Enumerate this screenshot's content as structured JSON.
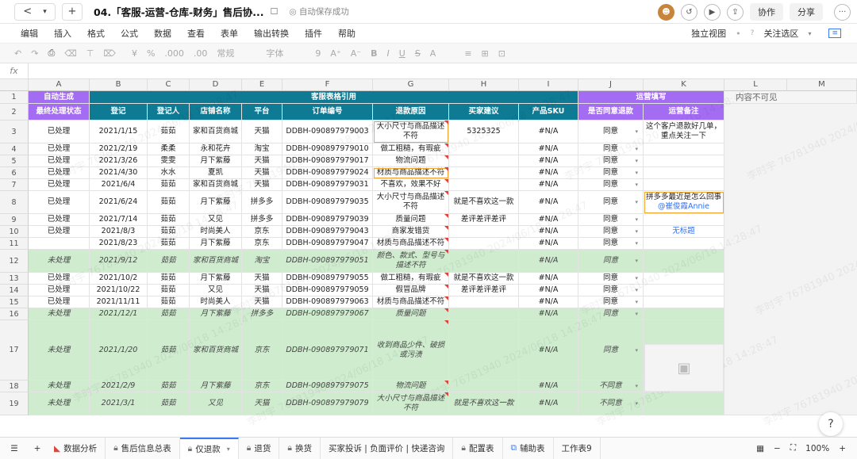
{
  "titlebar": {
    "back": "<",
    "chev": "▾",
    "add": "+",
    "title": "04.「客服-运营-仓库-财务」售后协...",
    "bookmark": "☐",
    "saved": "自动保存成功",
    "collab": "协作",
    "share": "分享",
    "more": "···"
  },
  "menus": [
    "编辑",
    "插入",
    "格式",
    "公式",
    "数据",
    "查看",
    "表单",
    "输出转换",
    "插件",
    "帮助"
  ],
  "menu_right": {
    "view": "独立视图",
    "dot": "•",
    "chev": "?",
    "focus": "关注选区",
    "chev2": "▾"
  },
  "toolbar": [
    "↶",
    "↷",
    "⎙",
    "⌫",
    "⊤",
    "⌦",
    "¥",
    "%",
    ".000",
    ".00",
    "常规",
    "字体",
    "9",
    "A⁺",
    "A⁻",
    "B",
    "I",
    "U",
    "S",
    "A",
    "≡",
    "⊞",
    "⊡"
  ],
  "fx": "fx",
  "columns": [
    "A",
    "B",
    "C",
    "D",
    "E",
    "F",
    "G",
    "H",
    "I",
    "J",
    "K",
    "L",
    "M"
  ],
  "header1": {
    "a": "自动生成",
    "bi": "客服表格引用",
    "jk": "运营填写",
    "l": "内容不可见"
  },
  "header2": [
    "最终处理状态",
    "登记",
    "登记人",
    "店铺名称",
    "平台",
    "订单编号",
    "退款原因",
    "买家建议",
    "产品SKU",
    "是否同意退款",
    "运营备注"
  ],
  "rows": [
    {
      "n": "3",
      "a": "已处理",
      "b": "2021/1/15",
      "c": "茹茹",
      "d": "家和百货商城",
      "e": "天猫",
      "f": "DDBH-090897979003",
      "g": "大小尺寸与商品描述不符",
      "h": "5325325",
      "i": "#N/A",
      "j": "同意",
      "k": "这个客户退款好几单，重点关注一下"
    },
    {
      "n": "4",
      "a": "已处理",
      "b": "2021/2/19",
      "c": "柔柔",
      "d": "永和花卉",
      "e": "淘宝",
      "f": "DDBH-090897979010",
      "g": "做工粗糙，有瑕疵",
      "h": "",
      "i": "#N/A",
      "j": "同意",
      "k": ""
    },
    {
      "n": "5",
      "a": "已处理",
      "b": "2021/3/26",
      "c": "雯雯",
      "d": "月下紫藤",
      "e": "天猫",
      "f": "DDBH-090897979017",
      "g": "物流问题",
      "h": "",
      "i": "#N/A",
      "j": "同意",
      "k": ""
    },
    {
      "n": "6",
      "a": "已处理",
      "b": "2021/4/30",
      "c": "水水",
      "d": "夏凯",
      "e": "天猫",
      "f": "DDBH-090897979024",
      "g": "材质与商品描述不符",
      "h": "",
      "i": "#N/A",
      "j": "同意",
      "k": ""
    },
    {
      "n": "7",
      "a": "已处理",
      "b": "2021/6/4",
      "c": "茹茹",
      "d": "家和百货商城",
      "e": "天猫",
      "f": "DDBH-090897979031",
      "g": "不喜欢，效果不好",
      "h": "",
      "i": "#N/A",
      "j": "同意",
      "k": ""
    },
    {
      "n": "8",
      "a": "已处理",
      "b": "2021/6/24",
      "c": "茹茹",
      "d": "月下紫藤",
      "e": "拼多多",
      "f": "DDBH-090897979035",
      "g": "大小尺寸与商品描述不符",
      "h": "就是不喜欢这一款",
      "i": "#N/A",
      "j": "同意",
      "k": "拼多多最近是怎么回事",
      "k2": "@崔俊霞Annie"
    },
    {
      "n": "9",
      "a": "已处理",
      "b": "2021/7/14",
      "c": "茹茹",
      "d": "又见",
      "e": "拼多多",
      "f": "DDBH-090897979039",
      "g": "质量问题",
      "h": "差评差评差评",
      "i": "#N/A",
      "j": "同意",
      "k": ""
    },
    {
      "n": "10",
      "a": "已处理",
      "b": "2021/8/3",
      "c": "茹茹",
      "d": "时尚美人",
      "e": "京东",
      "f": "DDBH-090897979043",
      "g": "商家发错货",
      "h": "",
      "i": "#N/A",
      "j": "同意",
      "k": "无标题"
    },
    {
      "n": "11",
      "a": "",
      "b": "2021/8/23",
      "c": "茹茹",
      "d": "月下紫藤",
      "e": "京东",
      "f": "DDBH-090897979047",
      "g": "材质与商品描述不符",
      "h": "",
      "i": "#N/A",
      "j": "同意",
      "k": ""
    },
    {
      "n": "12",
      "a": "未处理",
      "b": "2021/9/12",
      "c": "茹茹",
      "d": "家和百货商城",
      "e": "淘宝",
      "f": "DDBH-090897979051",
      "g": "颜色、款式、型号与描述不符",
      "h": "",
      "i": "#N/A",
      "j": "同意",
      "k": ""
    },
    {
      "n": "13",
      "a": "已处理",
      "b": "2021/10/2",
      "c": "茹茹",
      "d": "月下紫藤",
      "e": "天猫",
      "f": "DDBH-090897979055",
      "g": "做工粗糙，有瑕疵",
      "h": "就是不喜欢这一款",
      "i": "#N/A",
      "j": "同意",
      "k": ""
    },
    {
      "n": "14",
      "a": "已处理",
      "b": "2021/10/22",
      "c": "茹茹",
      "d": "又见",
      "e": "天猫",
      "f": "DDBH-090897979059",
      "g": "假冒品牌",
      "h": "差评差评差评",
      "i": "#N/A",
      "j": "同意",
      "k": ""
    },
    {
      "n": "15",
      "a": "已处理",
      "b": "2021/11/11",
      "c": "茹茹",
      "d": "时尚美人",
      "e": "天猫",
      "f": "DDBH-090897979063",
      "g": "材质与商品描述不符",
      "h": "",
      "i": "#N/A",
      "j": "同意",
      "k": ""
    },
    {
      "n": "16",
      "a": "未处理",
      "b": "2021/12/1",
      "c": "茹茹",
      "d": "月下紫藤",
      "e": "拼多多",
      "f": "DDBH-090897979067",
      "g": "质量问题",
      "h": "",
      "i": "#N/A",
      "j": "同意",
      "k": ""
    },
    {
      "n": "17",
      "a": "未处理",
      "b": "2021/1/20",
      "c": "茹茹",
      "d": "家和百货商城",
      "e": "京东",
      "f": "DDBH-090897979071",
      "g": "收到商品少件、破损或污渍",
      "h": "",
      "i": "#N/A",
      "j": "同意",
      "k": ""
    },
    {
      "n": "18",
      "a": "未处理",
      "b": "2021/2/9",
      "c": "茹茹",
      "d": "月下紫藤",
      "e": "京东",
      "f": "DDBH-090897979075",
      "g": "物流问题",
      "h": "",
      "i": "#N/A",
      "j": "不同意",
      "k": ""
    },
    {
      "n": "19",
      "a": "未处理",
      "b": "2021/3/1",
      "c": "茹茹",
      "d": "又见",
      "e": "天猫",
      "f": "DDBH-090897979079",
      "g": "大小尺寸与商品描述不符",
      "h": "就是不喜欢这一款",
      "i": "#N/A",
      "j": "不同意",
      "k": ""
    }
  ],
  "rownums": {
    "r1": "1",
    "r2": "2"
  },
  "tabs": [
    "数据分析",
    "售后信息总表",
    "仅退款",
    "退货",
    "换货",
    "买家投诉 | 负面评价 | 快递咨询",
    "配置表",
    "辅助表",
    "工作表9"
  ],
  "bottom": {
    "menu": "☰",
    "add": "+",
    "zoom": "100%",
    "minus": "−",
    "plus": "+"
  },
  "watermark": "李时宇 76781940 2024/06/18 14:28:47",
  "help": "?"
}
